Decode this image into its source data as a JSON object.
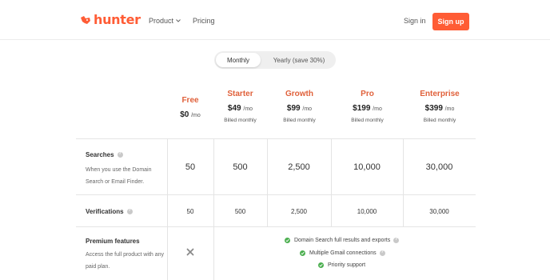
{
  "header": {
    "logo_text": "hunter",
    "nav": [
      {
        "label": "Product",
        "has_dropdown": true
      },
      {
        "label": "Pricing",
        "has_dropdown": false
      }
    ],
    "signin_label": "Sign in",
    "signup_label": "Sign up"
  },
  "toggle": {
    "monthly": "Monthly",
    "yearly": "Yearly (save 30%)",
    "selected": "Monthly"
  },
  "plans": [
    {
      "name": "Free",
      "price": "$0",
      "unit": "/mo",
      "note": ""
    },
    {
      "name": "Starter",
      "price": "$49",
      "unit": "/mo",
      "note": "Billed monthly"
    },
    {
      "name": "Growth",
      "price": "$99",
      "unit": "/mo",
      "note": "Billed monthly"
    },
    {
      "name": "Pro",
      "price": "$199",
      "unit": "/mo",
      "note": "Billed monthly"
    },
    {
      "name": "Enterprise",
      "price": "$399",
      "unit": "/mo",
      "note": "Billed monthly"
    }
  ],
  "rows": {
    "searches": {
      "title": "Searches",
      "desc": "When you use the Domain Search or Email Finder.",
      "values": [
        "50",
        "500",
        "2,500",
        "10,000",
        "30,000"
      ]
    },
    "verifications": {
      "title": "Verifications",
      "values": [
        "50",
        "500",
        "2,500",
        "10,000",
        "30,000"
      ]
    },
    "premium": {
      "title": "Premium features",
      "desc": "Access the full product with any paid plan.",
      "free_included": false,
      "features": [
        "Domain Search full results and exports",
        "Multiple Gmail connections",
        "Priority support"
      ]
    }
  },
  "colors": {
    "brand": "#ff5c35",
    "plan_name": "#e0613b",
    "check": "#4caf50"
  },
  "icons": {
    "logo": "fox-icon",
    "help": "question-circle-icon",
    "included": "check-circle-icon",
    "excluded": "cross-icon"
  }
}
